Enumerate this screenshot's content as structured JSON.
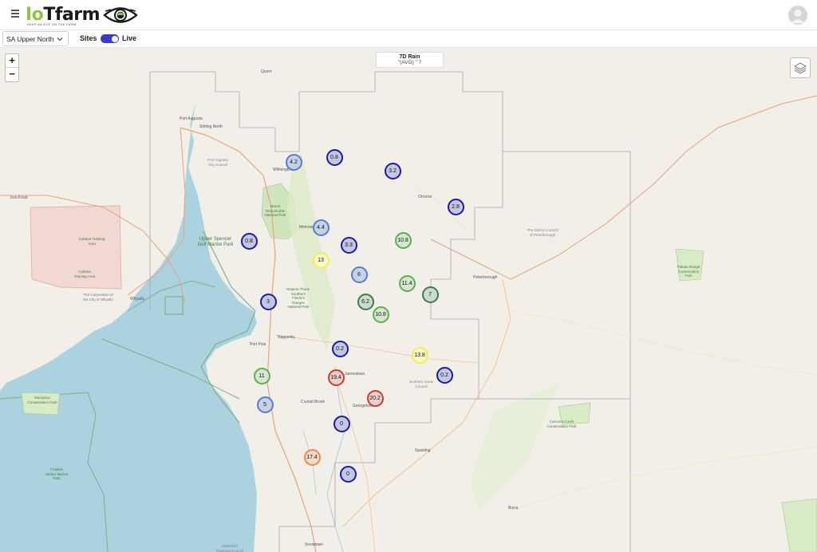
{
  "header": {
    "menu_icon": "hamburger-icon",
    "logo_io": "Io",
    "logo_rest": "Tfarm",
    "logo_tagline": "KEEP AN EYE ON THE FARM",
    "logo_icon": "eye-icon",
    "avatar_icon": "user-avatar-icon"
  },
  "toolbar": {
    "region": "SA Upper North",
    "sites_label": "Sites",
    "live_label": "Live",
    "live_on": true
  },
  "map": {
    "zoom_in": "+",
    "zoom_out": "−",
    "layers_icon": "layers-icon",
    "legend_title": "7D Rain",
    "legend_sub": "\"(AVG) \" 7"
  },
  "colors": {
    "blue_dark": "#1a1aa8",
    "blue_light": "#4f7fd8",
    "green": "#5bb04b",
    "green_dark": "#3c7d46",
    "yellow": "#f1ee52",
    "red": "#c93c2e",
    "orange": "#e48a50",
    "water": "#aad3df",
    "land": "#f2efe9"
  },
  "markers": [
    {
      "value": "4.2",
      "style": "blue_light"
    },
    {
      "value": "0.8",
      "style": "blue_dark"
    },
    {
      "value": "3.2",
      "style": "blue_dark"
    },
    {
      "value": "2.8",
      "style": "blue_dark"
    },
    {
      "value": "4.4",
      "style": "blue_light"
    },
    {
      "value": "0.8",
      "style": "blue_dark"
    },
    {
      "value": "3.3",
      "style": "blue_dark"
    },
    {
      "value": "10.8",
      "style": "green"
    },
    {
      "value": "13",
      "style": "yellow"
    },
    {
      "value": "6",
      "style": "blue_light"
    },
    {
      "value": "11.4",
      "style": "green"
    },
    {
      "value": "7",
      "style": "green_dark"
    },
    {
      "value": "3",
      "style": "blue_dark"
    },
    {
      "value": "6.2",
      "style": "green_dark"
    },
    {
      "value": "10.8",
      "style": "green"
    },
    {
      "value": "0.2",
      "style": "blue_dark"
    },
    {
      "value": "13.8",
      "style": "yellow"
    },
    {
      "value": "0.2",
      "style": "blue_dark"
    },
    {
      "value": "11",
      "style": "green"
    },
    {
      "value": "19.4",
      "style": "red"
    },
    {
      "value": "20.2",
      "style": "red"
    },
    {
      "value": "5",
      "style": "blue_light"
    },
    {
      "value": "0",
      "style": "blue_dark"
    },
    {
      "value": "17.4",
      "style": "orange"
    },
    {
      "value": "0",
      "style": "blue_dark"
    }
  ],
  "places": [
    "Quorn",
    "Port Augusta",
    "Stirling North",
    "Wilmington",
    "Iron Knob",
    "Orroroo",
    "Melrose",
    "Whyalla",
    "Peterborough",
    "Port Pirie",
    "Napperby",
    "Jamestown",
    "Crystal Brook",
    "Georgetown",
    "Spalding",
    "Burra",
    "Snowtown"
  ],
  "parks": [
    "Cultana Training Area",
    "Cultana Training Area",
    "Mount Remarkable National Park",
    "Upper Spencer Gulf Marine Park",
    "Wapma Thura-Southern Flinders Ranges National Park",
    "The Corporation of the City of Whyalla",
    "The District Council of Peterborough",
    "Pukatu Range Conservation Park",
    "Munyaroo Conservation Park",
    "Franklin Harbor Marine Park",
    "Northern Areas Council",
    "Caroona Creek Conservation Park",
    "Port Augusta City Council",
    "Wakefield Regional Council"
  ]
}
